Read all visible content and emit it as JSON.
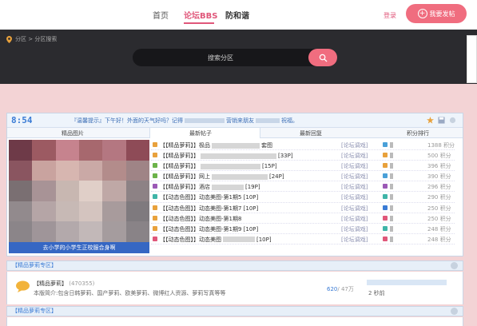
{
  "nav": {
    "home": "首页",
    "bbs": "论坛BBS",
    "defense": "防和谐",
    "login": "登录",
    "post": "我要发帖"
  },
  "breadcrumb": {
    "text": "分区 > 分区搜索"
  },
  "search": {
    "label": "搜索分区"
  },
  "panel": {
    "clock": "8:54",
    "tip_prefix": "『温馨提示』下午好！外面的天气好吗？记得",
    "tip_middle": "营销来朋友",
    "tip_suffix": "祝福。",
    "tabs": [
      "精品图片",
      "最新帖子",
      "最新回复",
      "积分排行"
    ],
    "image_caption": "去小学的小学生正校服合身啊"
  },
  "posts": [
    {
      "title": "【【精品萝莉】】极品",
      "tail": "套图",
      "category": "[论坛调戏]",
      "score": "1388 积分",
      "color": "#e8a13c",
      "color2": "#4aa0d8"
    },
    {
      "title": "【【精品萝莉】】",
      "tail": "[33P]",
      "category": "[论坛调戏]",
      "score": "500 积分",
      "color": "#e8a13c",
      "color2": "#e8a13c"
    },
    {
      "title": "【【精品萝莉】】",
      "tail": "[15P]",
      "category": "[论坛调戏]",
      "score": "396 积分",
      "color": "#6cb34a",
      "color2": "#e8a13c"
    },
    {
      "title": "【【精品萝莉】】网上",
      "tail": "[24P]",
      "category": "[论坛调戏]",
      "score": "390 积分",
      "color": "#6cb34a",
      "color2": "#4aa0d8"
    },
    {
      "title": "【【精品萝莉】】酒店",
      "tail": "[19P]",
      "category": "[论坛调戏]",
      "score": "296 积分",
      "color": "#9b59b6",
      "color2": "#9b59b6"
    },
    {
      "title": "【【动态色图】】动态美图-第1期5 [10P]",
      "tail": "",
      "category": "[论坛调戏]",
      "score": "290 积分",
      "color": "#3fb5a8",
      "color2": "#3fb5a8"
    },
    {
      "title": "【【动态色图】】动态美图-第1期7 [10P]",
      "tail": "",
      "category": "[论坛调戏]",
      "score": "250 积分",
      "color": "#e8a13c",
      "color2": "#3a7bd5"
    },
    {
      "title": "【【动态色图】】动态美图-第1期8",
      "tail": "",
      "category": "[论坛调戏]",
      "score": "250 积分",
      "color": "#e8a13c",
      "color2": "#e0577a"
    },
    {
      "title": "【【动态色图】】动态美图-第1期9 [10P]",
      "tail": "",
      "category": "[论坛调戏]",
      "score": "248 积分",
      "color": "#e8a13c",
      "color2": "#3fb5a8"
    },
    {
      "title": "【【动态色图】】动态美图",
      "tail": "[10P]",
      "category": "[论坛调戏]",
      "score": "248 积分",
      "color": "#e0577a",
      "color2": "#e0577a"
    }
  ],
  "section1": {
    "title": "【精品萝莉专区】"
  },
  "forum": {
    "name": "【精品萝莉】",
    "count": "(470355)",
    "desc": "本版简介:包含日韩萝莉、国产萝莉、欧美萝莉、微博红人资源、萝莉写真等等",
    "today": "620",
    "total": "/ 47万",
    "last": "2 秒前"
  },
  "section2": {
    "title": "【精品萝莉专区】"
  },
  "colors": {
    "accent": "#f06d7f",
    "link": "#3a7bd5",
    "band": "#2b2b2f"
  }
}
